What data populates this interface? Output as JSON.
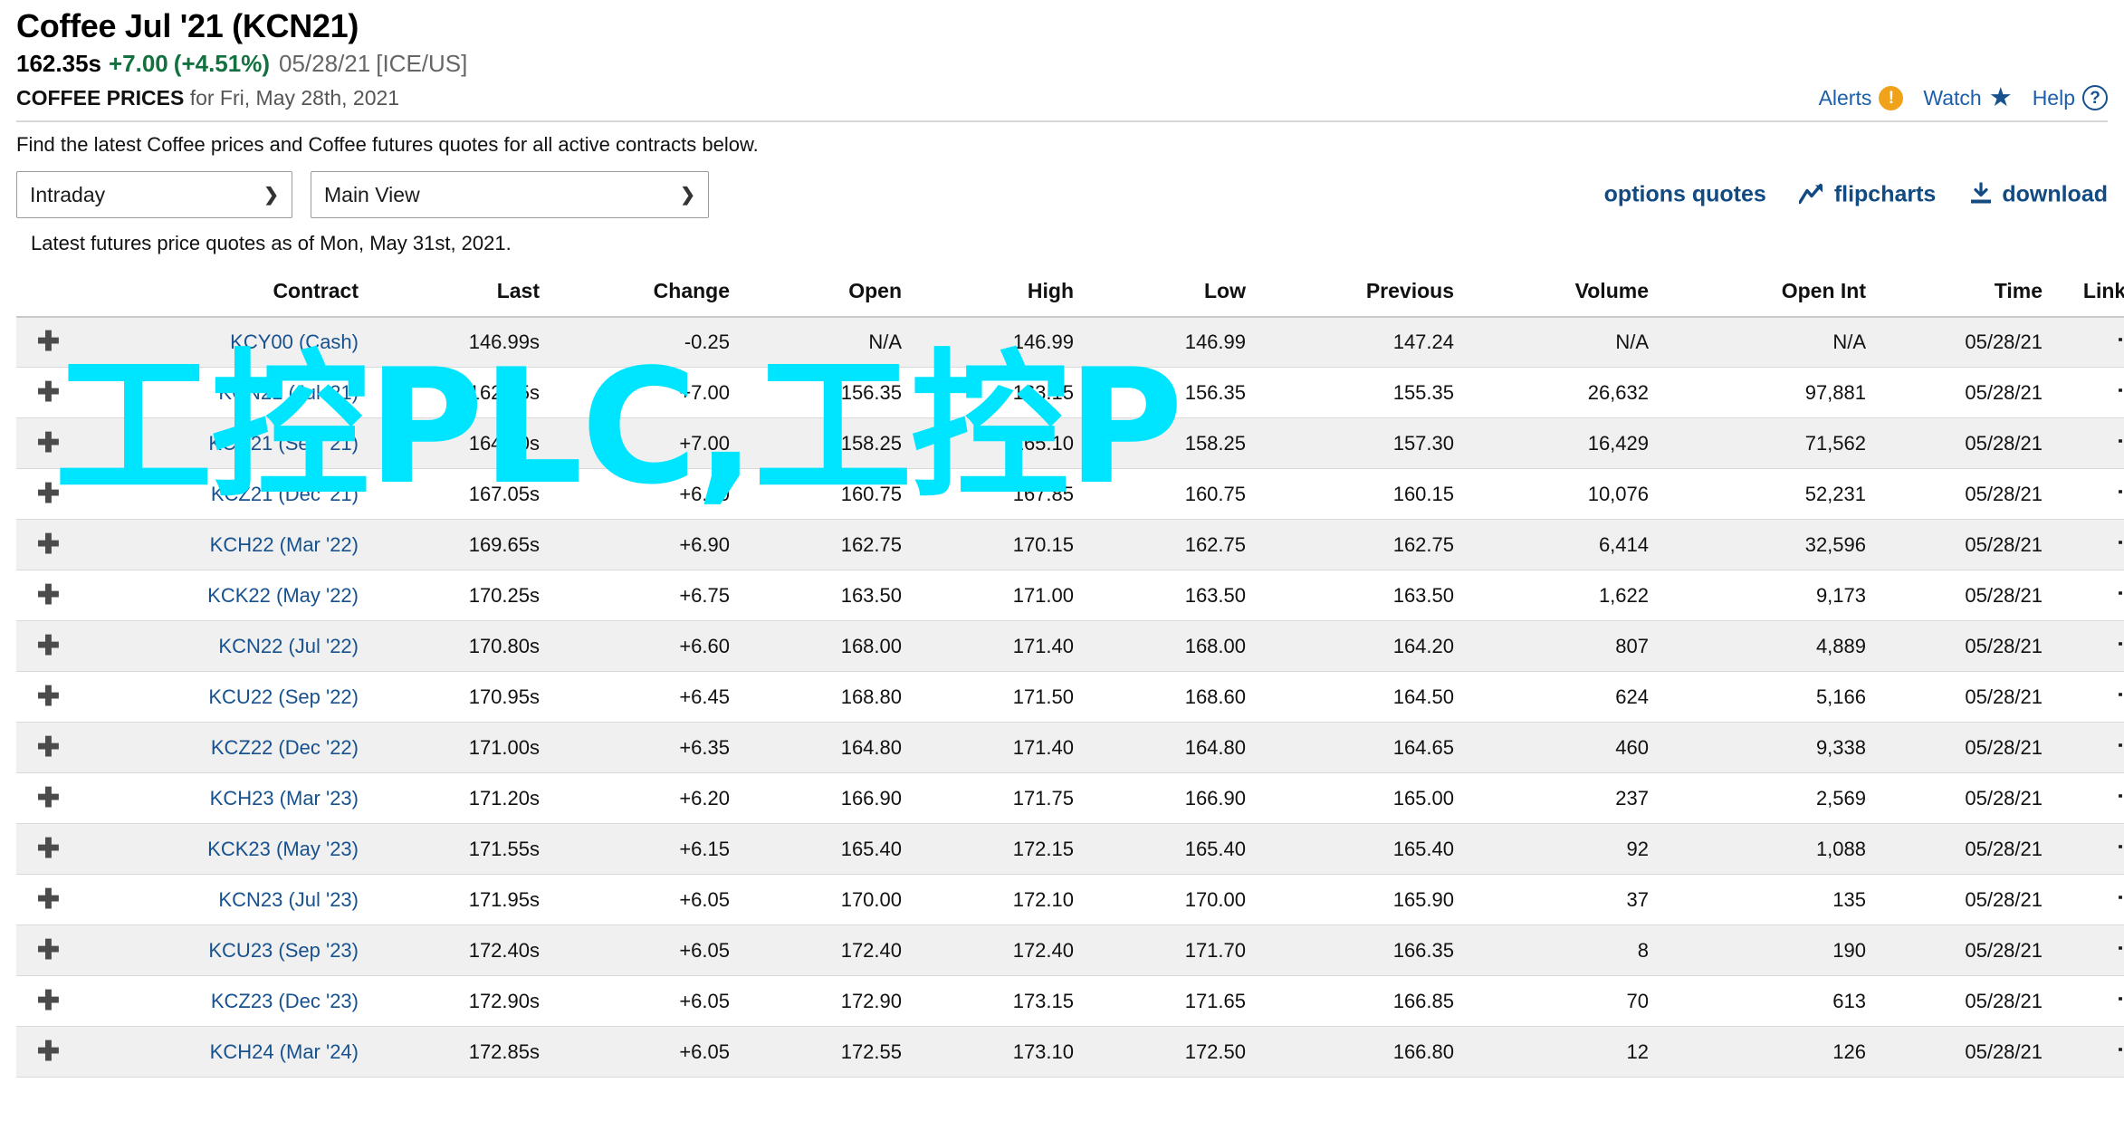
{
  "header": {
    "title": "Coffee Jul '21 (KCN21)",
    "last": "162.35s",
    "change": "+7.00",
    "change_pct": "(+4.51%)",
    "quote_date": "05/28/21",
    "exchange": "[ICE/US]",
    "section_label": "COFFEE PRICES",
    "section_rest": " for Fri, May 28th, 2021",
    "intro": "Find the latest Coffee prices and Coffee futures quotes for all active contracts below.",
    "links": [
      {
        "label": "Alerts",
        "icon": "alert-icon"
      },
      {
        "label": "Watch",
        "icon": "star-icon"
      },
      {
        "label": "Help",
        "icon": "help-icon"
      }
    ]
  },
  "toolbar": {
    "period_selected": "Intraday",
    "period_options": [
      "Intraday"
    ],
    "view_selected": "Main View",
    "view_options": [
      "Main View"
    ],
    "options_quotes": "options quotes",
    "flipcharts": "flipcharts",
    "download": "download",
    "as_of": "Latest futures price quotes as of Mon, May 31st, 2021."
  },
  "table": {
    "columns": [
      "Contract",
      "Last",
      "Change",
      "Open",
      "High",
      "Low",
      "Previous",
      "Volume",
      "Open Int",
      "Time",
      "Links"
    ],
    "expand_glyph": "✚",
    "links_glyph": "⋮",
    "rows": [
      {
        "contract": "KCY00 (Cash)",
        "last": "146.99s",
        "change": "-0.25",
        "dir": "down",
        "open": "N/A",
        "high": "146.99",
        "low": "146.99",
        "previous": "147.24",
        "volume": "N/A",
        "open_int": "N/A",
        "time": "05/28/21"
      },
      {
        "contract": "KCN21 (Jul '21)",
        "last": "162.35s",
        "change": "+7.00",
        "dir": "up",
        "open": "156.35",
        "high": "163.15",
        "low": "156.35",
        "previous": "155.35",
        "volume": "26,632",
        "open_int": "97,881",
        "time": "05/28/21"
      },
      {
        "contract": "KCU21 (Sep '21)",
        "last": "164.30s",
        "change": "+7.00",
        "dir": "up",
        "open": "158.25",
        "high": "165.10",
        "low": "158.25",
        "previous": "157.30",
        "volume": "16,429",
        "open_int": "71,562",
        "time": "05/28/21"
      },
      {
        "contract": "KCZ21 (Dec '21)",
        "last": "167.05s",
        "change": "+6.90",
        "dir": "up",
        "open": "160.75",
        "high": "167.85",
        "low": "160.75",
        "previous": "160.15",
        "volume": "10,076",
        "open_int": "52,231",
        "time": "05/28/21"
      },
      {
        "contract": "KCH22 (Mar '22)",
        "last": "169.65s",
        "change": "+6.90",
        "dir": "up",
        "open": "162.75",
        "high": "170.15",
        "low": "162.75",
        "previous": "162.75",
        "volume": "6,414",
        "open_int": "32,596",
        "time": "05/28/21"
      },
      {
        "contract": "KCK22 (May '22)",
        "last": "170.25s",
        "change": "+6.75",
        "dir": "up",
        "open": "163.50",
        "high": "171.00",
        "low": "163.50",
        "previous": "163.50",
        "volume": "1,622",
        "open_int": "9,173",
        "time": "05/28/21"
      },
      {
        "contract": "KCN22 (Jul '22)",
        "last": "170.80s",
        "change": "+6.60",
        "dir": "up",
        "open": "168.00",
        "high": "171.40",
        "low": "168.00",
        "previous": "164.20",
        "volume": "807",
        "open_int": "4,889",
        "time": "05/28/21"
      },
      {
        "contract": "KCU22 (Sep '22)",
        "last": "170.95s",
        "change": "+6.45",
        "dir": "up",
        "open": "168.80",
        "high": "171.50",
        "low": "168.60",
        "previous": "164.50",
        "volume": "624",
        "open_int": "5,166",
        "time": "05/28/21"
      },
      {
        "contract": "KCZ22 (Dec '22)",
        "last": "171.00s",
        "change": "+6.35",
        "dir": "up",
        "open": "164.80",
        "high": "171.40",
        "low": "164.80",
        "previous": "164.65",
        "volume": "460",
        "open_int": "9,338",
        "time": "05/28/21"
      },
      {
        "contract": "KCH23 (Mar '23)",
        "last": "171.20s",
        "change": "+6.20",
        "dir": "up",
        "open": "166.90",
        "high": "171.75",
        "low": "166.90",
        "previous": "165.00",
        "volume": "237",
        "open_int": "2,569",
        "time": "05/28/21"
      },
      {
        "contract": "KCK23 (May '23)",
        "last": "171.55s",
        "change": "+6.15",
        "dir": "up",
        "open": "165.40",
        "high": "172.15",
        "low": "165.40",
        "previous": "165.40",
        "volume": "92",
        "open_int": "1,088",
        "time": "05/28/21"
      },
      {
        "contract": "KCN23 (Jul '23)",
        "last": "171.95s",
        "change": "+6.05",
        "dir": "up",
        "open": "170.00",
        "high": "172.10",
        "low": "170.00",
        "previous": "165.90",
        "volume": "37",
        "open_int": "135",
        "time": "05/28/21"
      },
      {
        "contract": "KCU23 (Sep '23)",
        "last": "172.40s",
        "change": "+6.05",
        "dir": "up",
        "open": "172.40",
        "high": "172.40",
        "low": "171.70",
        "previous": "166.35",
        "volume": "8",
        "open_int": "190",
        "time": "05/28/21"
      },
      {
        "contract": "KCZ23 (Dec '23)",
        "last": "172.90s",
        "change": "+6.05",
        "dir": "up",
        "open": "172.90",
        "high": "173.15",
        "low": "171.65",
        "previous": "166.85",
        "volume": "70",
        "open_int": "613",
        "time": "05/28/21"
      },
      {
        "contract": "KCH24 (Mar '24)",
        "last": "172.85s",
        "change": "+6.05",
        "dir": "up",
        "open": "172.55",
        "high": "173.10",
        "low": "172.50",
        "previous": "166.80",
        "volume": "12",
        "open_int": "126",
        "time": "05/28/21"
      }
    ]
  },
  "watermark": {
    "text": "工控PLC,工控P",
    "color": "#00e5ff"
  }
}
